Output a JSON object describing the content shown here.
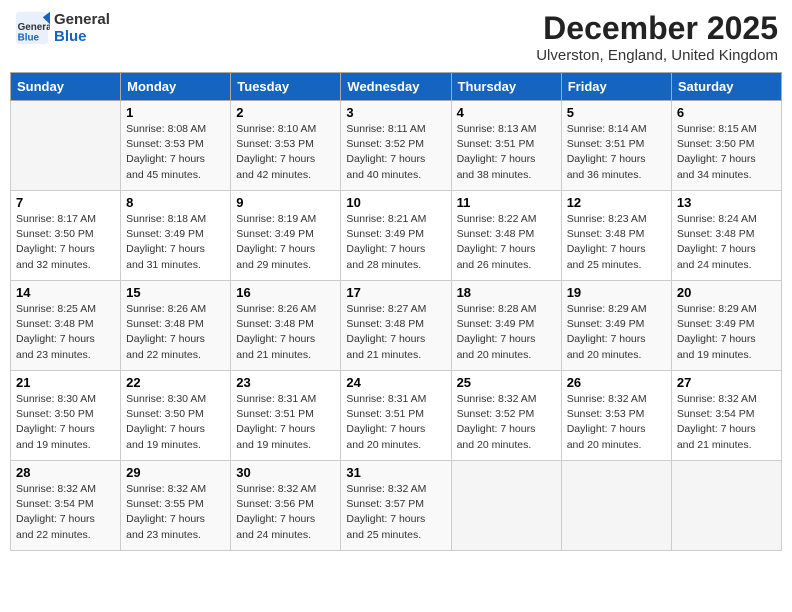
{
  "header": {
    "logo_general": "General",
    "logo_blue": "Blue",
    "month_title": "December 2025",
    "location": "Ulverston, England, United Kingdom"
  },
  "days_of_week": [
    "Sunday",
    "Monday",
    "Tuesday",
    "Wednesday",
    "Thursday",
    "Friday",
    "Saturday"
  ],
  "weeks": [
    [
      {
        "day": "",
        "info": ""
      },
      {
        "day": "1",
        "info": "Sunrise: 8:08 AM\nSunset: 3:53 PM\nDaylight: 7 hours\nand 45 minutes."
      },
      {
        "day": "2",
        "info": "Sunrise: 8:10 AM\nSunset: 3:53 PM\nDaylight: 7 hours\nand 42 minutes."
      },
      {
        "day": "3",
        "info": "Sunrise: 8:11 AM\nSunset: 3:52 PM\nDaylight: 7 hours\nand 40 minutes."
      },
      {
        "day": "4",
        "info": "Sunrise: 8:13 AM\nSunset: 3:51 PM\nDaylight: 7 hours\nand 38 minutes."
      },
      {
        "day": "5",
        "info": "Sunrise: 8:14 AM\nSunset: 3:51 PM\nDaylight: 7 hours\nand 36 minutes."
      },
      {
        "day": "6",
        "info": "Sunrise: 8:15 AM\nSunset: 3:50 PM\nDaylight: 7 hours\nand 34 minutes."
      }
    ],
    [
      {
        "day": "7",
        "info": "Sunrise: 8:17 AM\nSunset: 3:50 PM\nDaylight: 7 hours\nand 32 minutes."
      },
      {
        "day": "8",
        "info": "Sunrise: 8:18 AM\nSunset: 3:49 PM\nDaylight: 7 hours\nand 31 minutes."
      },
      {
        "day": "9",
        "info": "Sunrise: 8:19 AM\nSunset: 3:49 PM\nDaylight: 7 hours\nand 29 minutes."
      },
      {
        "day": "10",
        "info": "Sunrise: 8:21 AM\nSunset: 3:49 PM\nDaylight: 7 hours\nand 28 minutes."
      },
      {
        "day": "11",
        "info": "Sunrise: 8:22 AM\nSunset: 3:48 PM\nDaylight: 7 hours\nand 26 minutes."
      },
      {
        "day": "12",
        "info": "Sunrise: 8:23 AM\nSunset: 3:48 PM\nDaylight: 7 hours\nand 25 minutes."
      },
      {
        "day": "13",
        "info": "Sunrise: 8:24 AM\nSunset: 3:48 PM\nDaylight: 7 hours\nand 24 minutes."
      }
    ],
    [
      {
        "day": "14",
        "info": "Sunrise: 8:25 AM\nSunset: 3:48 PM\nDaylight: 7 hours\nand 23 minutes."
      },
      {
        "day": "15",
        "info": "Sunrise: 8:26 AM\nSunset: 3:48 PM\nDaylight: 7 hours\nand 22 minutes."
      },
      {
        "day": "16",
        "info": "Sunrise: 8:26 AM\nSunset: 3:48 PM\nDaylight: 7 hours\nand 21 minutes."
      },
      {
        "day": "17",
        "info": "Sunrise: 8:27 AM\nSunset: 3:48 PM\nDaylight: 7 hours\nand 21 minutes."
      },
      {
        "day": "18",
        "info": "Sunrise: 8:28 AM\nSunset: 3:49 PM\nDaylight: 7 hours\nand 20 minutes."
      },
      {
        "day": "19",
        "info": "Sunrise: 8:29 AM\nSunset: 3:49 PM\nDaylight: 7 hours\nand 20 minutes."
      },
      {
        "day": "20",
        "info": "Sunrise: 8:29 AM\nSunset: 3:49 PM\nDaylight: 7 hours\nand 19 minutes."
      }
    ],
    [
      {
        "day": "21",
        "info": "Sunrise: 8:30 AM\nSunset: 3:50 PM\nDaylight: 7 hours\nand 19 minutes."
      },
      {
        "day": "22",
        "info": "Sunrise: 8:30 AM\nSunset: 3:50 PM\nDaylight: 7 hours\nand 19 minutes."
      },
      {
        "day": "23",
        "info": "Sunrise: 8:31 AM\nSunset: 3:51 PM\nDaylight: 7 hours\nand 19 minutes."
      },
      {
        "day": "24",
        "info": "Sunrise: 8:31 AM\nSunset: 3:51 PM\nDaylight: 7 hours\nand 20 minutes."
      },
      {
        "day": "25",
        "info": "Sunrise: 8:32 AM\nSunset: 3:52 PM\nDaylight: 7 hours\nand 20 minutes."
      },
      {
        "day": "26",
        "info": "Sunrise: 8:32 AM\nSunset: 3:53 PM\nDaylight: 7 hours\nand 20 minutes."
      },
      {
        "day": "27",
        "info": "Sunrise: 8:32 AM\nSunset: 3:54 PM\nDaylight: 7 hours\nand 21 minutes."
      }
    ],
    [
      {
        "day": "28",
        "info": "Sunrise: 8:32 AM\nSunset: 3:54 PM\nDaylight: 7 hours\nand 22 minutes."
      },
      {
        "day": "29",
        "info": "Sunrise: 8:32 AM\nSunset: 3:55 PM\nDaylight: 7 hours\nand 23 minutes."
      },
      {
        "day": "30",
        "info": "Sunrise: 8:32 AM\nSunset: 3:56 PM\nDaylight: 7 hours\nand 24 minutes."
      },
      {
        "day": "31",
        "info": "Sunrise: 8:32 AM\nSunset: 3:57 PM\nDaylight: 7 hours\nand 25 minutes."
      },
      {
        "day": "",
        "info": ""
      },
      {
        "day": "",
        "info": ""
      },
      {
        "day": "",
        "info": ""
      }
    ]
  ]
}
